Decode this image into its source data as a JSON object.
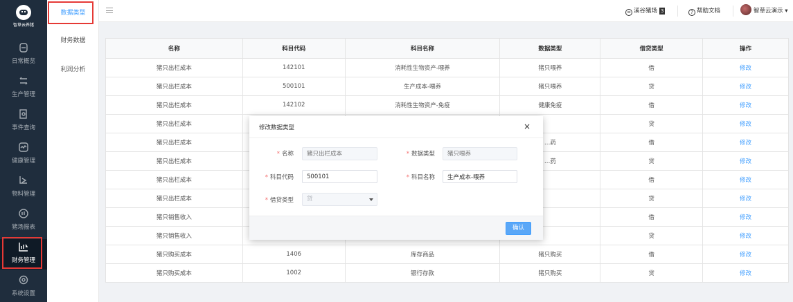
{
  "logo": {
    "text": "智草云养猪"
  },
  "nav": [
    {
      "label": "日常概览",
      "icon": "dashboard-icon"
    },
    {
      "label": "生产管理",
      "icon": "production-icon"
    },
    {
      "label": "事件查询",
      "icon": "search-doc-icon"
    },
    {
      "label": "健康管理",
      "icon": "health-icon"
    },
    {
      "label": "物料管理",
      "icon": "material-icon"
    },
    {
      "label": "猪场报表",
      "icon": "report-icon"
    },
    {
      "label": "财务管理",
      "icon": "finance-icon",
      "active": true
    },
    {
      "label": "系统设置",
      "icon": "gear-icon"
    }
  ],
  "subnav": [
    {
      "label": "数据类型",
      "active": true
    },
    {
      "label": "财务数据"
    },
    {
      "label": "利润分析"
    }
  ],
  "header": {
    "farm_label": "溪谷猪场",
    "farm_badge": "3",
    "help_label": "帮助文档",
    "user_label": "智草云演示"
  },
  "table": {
    "columns": [
      "名称",
      "科目代码",
      "科目名称",
      "数据类型",
      "借贷类型",
      "操作"
    ],
    "rows": [
      [
        "猪只出栏成本",
        "142101",
        "消耗性生物资产-喂养",
        "猪只喂养",
        "借",
        "修改"
      ],
      [
        "猪只出栏成本",
        "500101",
        "生产成本-喂养",
        "猪只喂养",
        "贷",
        "修改"
      ],
      [
        "猪只出栏成本",
        "142102",
        "消耗性生物资产-免疫",
        "健康免疫",
        "借",
        "修改"
      ],
      [
        "猪只出栏成本",
        "",
        "",
        "",
        "贷",
        "修改"
      ],
      [
        "猪只出栏成本",
        "",
        "",
        "…药",
        "借",
        "修改"
      ],
      [
        "猪只出栏成本",
        "",
        "",
        "…药",
        "贷",
        "修改"
      ],
      [
        "猪只出栏成本",
        "",
        "",
        "",
        "借",
        "修改"
      ],
      [
        "猪只出栏成本",
        "",
        "",
        "",
        "贷",
        "修改"
      ],
      [
        "猪只销售收入",
        "",
        "",
        "",
        "借",
        "修改"
      ],
      [
        "猪只销售收入",
        "",
        "",
        "",
        "贷",
        "修改"
      ],
      [
        "猪只购买成本",
        "1406",
        "库存商品",
        "猪只购买",
        "借",
        "修改"
      ],
      [
        "猪只购买成本",
        "1002",
        "银行存款",
        "猪只购买",
        "贷",
        "修改"
      ]
    ]
  },
  "modal": {
    "title": "修改数据类型",
    "close": "×",
    "fields": {
      "name_label": "名称",
      "name_placeholder": "猪只出栏成本",
      "datatype_label": "数据类型",
      "datatype_placeholder": "猪只喂养",
      "code_label": "科目代码",
      "code_value": "500101",
      "subject_label": "科目名称",
      "subject_value": "生产成本-喂养",
      "dc_label": "借贷类型",
      "dc_value": "贷"
    },
    "ok_label": "确认"
  }
}
